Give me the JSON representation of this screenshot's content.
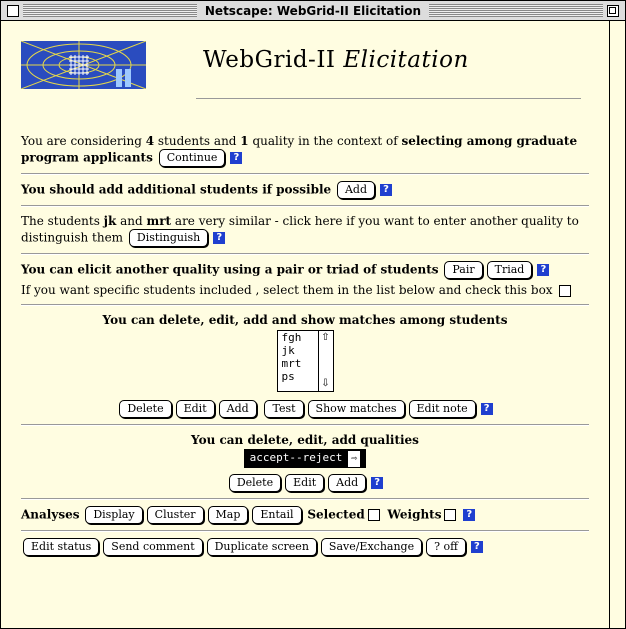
{
  "window": {
    "title": "Netscape: WebGrid-II Elicitation"
  },
  "header": {
    "title_plain": "WebGrid-II",
    "title_italic": "Elicitation"
  },
  "intro": {
    "t1": "You are considering ",
    "n_students": "4",
    "t2": " students and ",
    "n_qualities": "1",
    "t3": " quality in the context of ",
    "context": "selecting among graduate program applicants",
    "continue_label": "Continue"
  },
  "add_section": {
    "text": "You should add additional students if possible",
    "add_label": "Add"
  },
  "similar": {
    "t1": "The students ",
    "s1": "jk",
    "t2": " and ",
    "s2": "mrt",
    "t3": " are very similar - click here if you want to enter another quality to distinguish them",
    "button": "Distinguish"
  },
  "elicit": {
    "text": "You can elicit another quality using a pair or triad of students",
    "pair": "Pair",
    "triad": "Triad",
    "note": "If you want specific students included , select them in the list below and check this box"
  },
  "students": {
    "heading": "You can delete, edit, add and show matches among students",
    "list": [
      "fgh",
      "jk",
      "mrt",
      "ps"
    ],
    "buttons": {
      "delete": "Delete",
      "edit": "Edit",
      "add": "Add",
      "test": "Test",
      "show_matches": "Show matches",
      "edit_note": "Edit note"
    }
  },
  "qualities": {
    "heading": "You can delete, edit, add qualities",
    "selected": "accept--reject",
    "buttons": {
      "delete": "Delete",
      "edit": "Edit",
      "add": "Add"
    }
  },
  "analyses": {
    "label": "Analyses",
    "display": "Display",
    "cluster": "Cluster",
    "map": "Map",
    "entail": "Entail",
    "selected": "Selected",
    "weights": "Weights"
  },
  "footer": {
    "edit_status": "Edit status",
    "send_comment": "Send comment",
    "duplicate_screen": "Duplicate screen",
    "save_exchange": "Save/Exchange",
    "help_off": "? off"
  },
  "help_glyph": "?",
  "icons": {
    "scroll_up": "⇧",
    "scroll_down": "⇩",
    "popup_arrow": "⇨"
  },
  "colors": {
    "page_bg": "#fffde1",
    "help_blue": "#1f3fcf",
    "logo_blue": "#2a4cbf"
  }
}
